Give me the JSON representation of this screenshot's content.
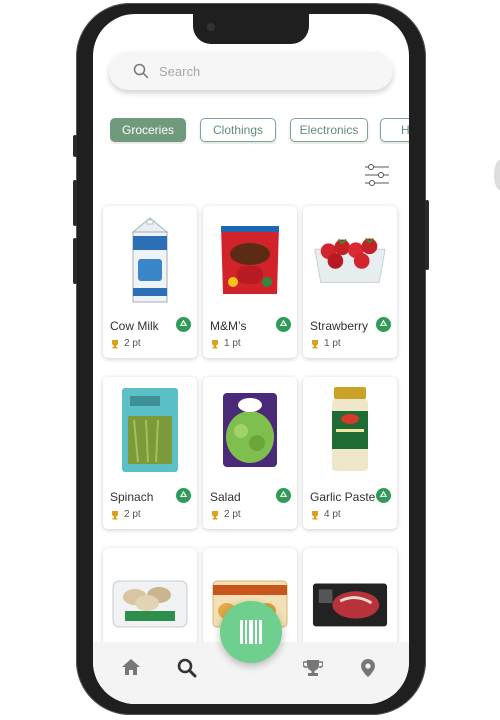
{
  "search": {
    "placeholder": "Search"
  },
  "categories": [
    {
      "label": "Groceries",
      "active": true
    },
    {
      "label": "Clothings",
      "active": false
    },
    {
      "label": "Electronics",
      "active": false
    },
    {
      "label": "H",
      "active": false
    }
  ],
  "products": [
    {
      "name": "Cow Milk",
      "points": "2 pt",
      "image": "milk-carton"
    },
    {
      "name": "M&M’s",
      "points": "1 pt",
      "image": "mm-bag"
    },
    {
      "name": "Strawberry",
      "points": "1 pt",
      "image": "strawberry-box"
    },
    {
      "name": "Spinach",
      "points": "2 pt",
      "image": "spinach-pack"
    },
    {
      "name": "Salad",
      "points": "2 pt",
      "image": "salad-bag"
    },
    {
      "name": "Garlic Paste",
      "points": "4 pt",
      "image": "garlic-jar"
    },
    {
      "name": "",
      "points": "",
      "image": "mushroom-pack"
    },
    {
      "name": "",
      "points": "",
      "image": "pastry-pack"
    },
    {
      "name": "",
      "points": "",
      "image": "steak-pack"
    }
  ],
  "nav": {
    "items": [
      "home-icon",
      "search-icon",
      "barcode-scan-icon",
      "trophy-icon",
      "location-pin-icon"
    ],
    "active": "search-icon"
  },
  "colors": {
    "accent": "#6f9b7c",
    "scan": "#6ecf8e",
    "recycle": "#2e9b58",
    "trophy": "#d9a21b"
  }
}
